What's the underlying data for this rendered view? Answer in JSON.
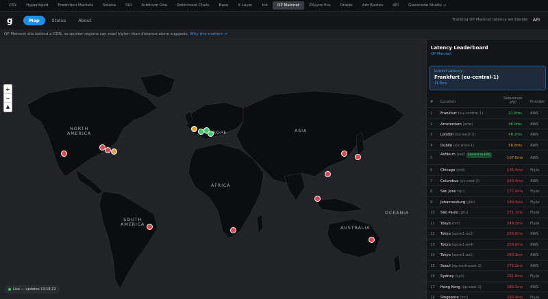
{
  "topbar": {
    "tabs": [
      "CEX",
      "Hyperliquid",
      "Prediction Markets",
      "Solana",
      "SUI",
      "Arbitrum One",
      "Robinhood Chain",
      "Base",
      "X Layer",
      "Ink",
      "OP Mainnet",
      "ZKsync Era",
      "Oracle",
      "Arb Routes",
      "API",
      "Glassnode Studio →"
    ],
    "active_index": 10
  },
  "navbar": {
    "logo": "g",
    "links": [
      "Map",
      "Status",
      "About"
    ],
    "active_index": 0,
    "tracking": "Tracking OP Mainnet latency worldwide",
    "api": "API"
  },
  "notice": {
    "text": "OP Mainnet sits behind a CDN, so quieter regions can read higher than distance alone suggests. ",
    "link": "Why this matters →"
  },
  "map": {
    "labels": {
      "north_america": "NORTH\nAMERICA",
      "europe": "EUROPE",
      "asia": "ASIA",
      "africa": "AFRICA",
      "south_america": "SOUTH\nAMERICA",
      "australia": "AUSTRALIA",
      "oceania": "OCEANIA"
    },
    "zoom": {
      "in": "+",
      "out": "−",
      "compass": "▲"
    },
    "status": "Live — updates 13:18:22",
    "status_color": "#3ec96a"
  },
  "leaderboard": {
    "title": "Latency Leaderboard",
    "subtitle": "OP Mainnet",
    "lowest_label": "Lowest Latency",
    "lowest_location": "Frankfurt (eu-central-1)",
    "lowest_value": "21.8ms",
    "headers": {
      "rank": "#",
      "location": "Location",
      "latency": "Sequencer p50",
      "provider": "Provider"
    },
    "rows": [
      {
        "rank": "1",
        "location": "Frankfurt",
        "code": "(eu-central-1)",
        "latency": "21.8ms",
        "color": "#3ec96a",
        "provider": "AWS",
        "tag": ""
      },
      {
        "rank": "2",
        "location": "Amsterdam",
        "code": "(ams)",
        "latency": "46.0ms",
        "color": "#3ec96a",
        "provider": "AWS",
        "tag": ""
      },
      {
        "rank": "3",
        "location": "London",
        "code": "(eu-west-2)",
        "latency": "48.2ms",
        "color": "#3ec96a",
        "provider": "AWS",
        "tag": ""
      },
      {
        "rank": "4",
        "location": "Dublin",
        "code": "(eu-west-1)",
        "latency": "56.8ms",
        "color": "#e6a23c",
        "provider": "AWS",
        "tag": ""
      },
      {
        "rank": "5",
        "location": "Ashburn",
        "code": "(iad)",
        "latency": "107.0ms",
        "color": "#e6a23c",
        "provider": "AWS",
        "tag": "Closest to RPC"
      },
      {
        "rank": "6",
        "location": "Chicago",
        "code": "(ord)",
        "latency": "135.4ms",
        "color": "#e0454e",
        "provider": "Fly.io",
        "tag": ""
      },
      {
        "rank": "7",
        "location": "Columbus",
        "code": "(us-east-2)",
        "latency": "150.4ms",
        "color": "#e0454e",
        "provider": "AWS",
        "tag": ""
      },
      {
        "rank": "8",
        "location": "San Jose",
        "code": "(sjc)",
        "latency": "177.0ms",
        "color": "#e0454e",
        "provider": "Fly.io",
        "tag": ""
      },
      {
        "rank": "9",
        "location": "Johannesburg",
        "code": "(jnb)",
        "latency": "180.3ms",
        "color": "#e0454e",
        "provider": "Fly.io",
        "tag": ""
      },
      {
        "rank": "10",
        "location": "São Paulo",
        "code": "(gru)",
        "latency": "271.7ms",
        "color": "#e0454e",
        "provider": "Fly.io",
        "tag": ""
      },
      {
        "rank": "11",
        "location": "Tokyo",
        "code": "(nrt)",
        "latency": "249.2ms",
        "color": "#e0454e",
        "provider": "Fly.io",
        "tag": ""
      },
      {
        "rank": "12",
        "location": "Tokyo",
        "code": "(apne1-az2)",
        "latency": "256.0ms",
        "color": "#e0454e",
        "provider": "AWS",
        "tag": ""
      },
      {
        "rank": "13",
        "location": "Tokyo",
        "code": "(apne1-az4)",
        "latency": "258.0ms",
        "color": "#e0454e",
        "provider": "AWS",
        "tag": ""
      },
      {
        "rank": "14",
        "location": "Tokyo",
        "code": "(apne1-az1)",
        "latency": "260.3ms",
        "color": "#e0454e",
        "provider": "AWS",
        "tag": ""
      },
      {
        "rank": "15",
        "location": "Seoul",
        "code": "(ap-northeast-2)",
        "latency": "275.2ms",
        "color": "#e0454e",
        "provider": "AWS",
        "tag": ""
      },
      {
        "rank": "16",
        "location": "Sydney",
        "code": "(syd)",
        "latency": "281.0ms",
        "color": "#e0454e",
        "provider": "Fly.io",
        "tag": ""
      },
      {
        "rank": "17",
        "location": "Hong Kong",
        "code": "(ap-east-1)",
        "latency": "283.1ms",
        "color": "#e0454e",
        "provider": "AWS",
        "tag": ""
      },
      {
        "rank": "18",
        "location": "Singapore",
        "code": "(sin)",
        "latency": "290.4ms",
        "color": "#e0454e",
        "provider": "Fly.io",
        "tag": ""
      }
    ]
  },
  "markers": [
    {
      "name": "san-jose",
      "color": "#e0454e"
    },
    {
      "name": "chicago",
      "color": "#e0454e"
    },
    {
      "name": "columbus",
      "color": "#e0454e"
    },
    {
      "name": "ashburn",
      "color": "#e6a23c"
    },
    {
      "name": "dublin",
      "color": "#e6a23c"
    },
    {
      "name": "london",
      "color": "#3ec96a"
    },
    {
      "name": "amsterdam",
      "color": "#3ec96a"
    },
    {
      "name": "frankfurt",
      "color": "#3ec96a"
    },
    {
      "name": "sao-paulo",
      "color": "#e0454e"
    },
    {
      "name": "johannesburg",
      "color": "#e0454e"
    },
    {
      "name": "seoul",
      "color": "#e0454e"
    },
    {
      "name": "tokyo",
      "color": "#e0454e"
    },
    {
      "name": "hong-kong",
      "color": "#e0454e"
    },
    {
      "name": "singapore",
      "color": "#e0454e"
    },
    {
      "name": "sydney",
      "color": "#e0454e"
    }
  ]
}
